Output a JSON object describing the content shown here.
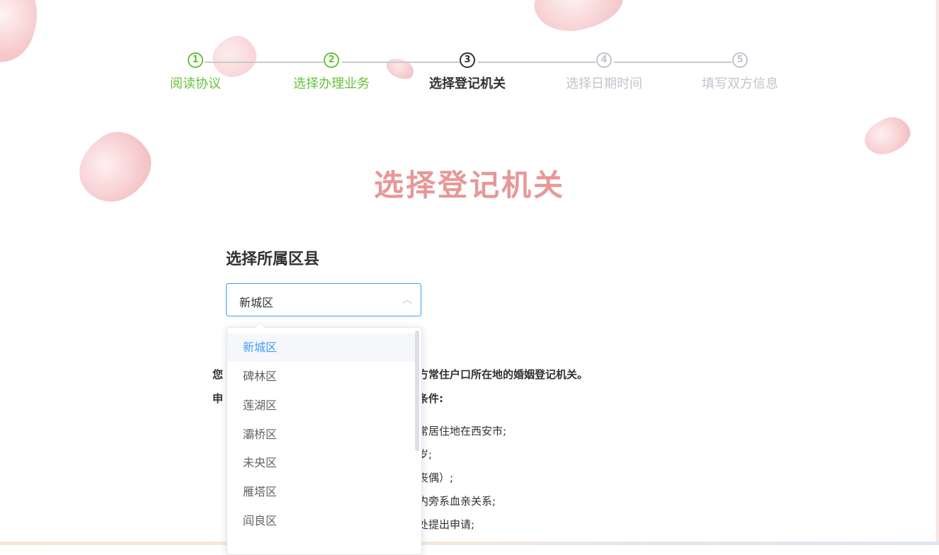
{
  "steps": [
    {
      "num": "1",
      "label": "阅读协议",
      "state": "done"
    },
    {
      "num": "2",
      "label": "选择办理业务",
      "state": "done"
    },
    {
      "num": "3",
      "label": "选择登记机关",
      "state": "active"
    },
    {
      "num": "4",
      "label": "选择日期时间",
      "state": "pending"
    },
    {
      "num": "5",
      "label": "填写双方信息",
      "state": "pending"
    }
  ],
  "page_title": "选择登记机关",
  "district": {
    "label": "选择所属区县",
    "selected": "新城区",
    "chevron": "^",
    "options": [
      "新城区",
      "碑林区",
      "莲湖区",
      "灞桥区",
      "未央区",
      "雁塔区",
      "阎良区"
    ]
  },
  "info": {
    "line1_prefix": "您",
    "line1": "方常住户口所在地的婚姻登记机关。",
    "line2_prefix": "申",
    "line2": "条件:",
    "items": [
      "常居住地在西安市;",
      "岁;",
      "丧偶）;",
      "内旁系血亲关系;",
      "处提出申请;"
    ]
  },
  "colors": {
    "accent": "#409eff",
    "done": "#67c23a",
    "title": "#e89798",
    "pending": "#c0c4cc"
  }
}
